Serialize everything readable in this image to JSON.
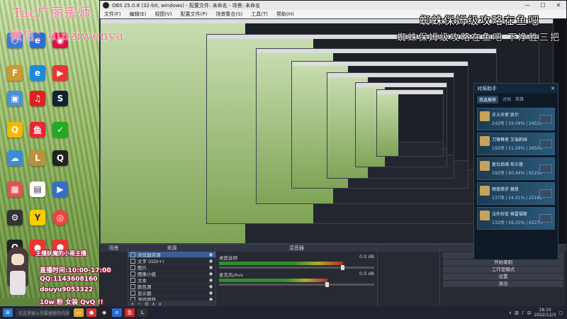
{
  "obs": {
    "title": "OBS 25.0.8 (32-bit, windows) - 配置文件: 未命名 - 场景: 未命名",
    "menu": [
      "文件(F)",
      "编辑(E)",
      "视图(V)",
      "配置文件(P)",
      "场景集合(S)",
      "工具(T)",
      "帮助(H)"
    ],
    "window_controls": [
      "—",
      "☐",
      "✕"
    ]
  },
  "overlay": {
    "teacher": "Tac广丽宗师",
    "wechat": "微信：dinziwenya",
    "headline": "蜘蛛保姆级攻略在鱼吧",
    "subline": "蜘蛛保姆级攻略在鱼吧 下净胜三把"
  },
  "game": {
    "header": "对局助手",
    "tabs": [
      "我选推荐",
      "对局",
      "英雄"
    ],
    "rows": [
      {
        "name": "正义天使 凯尔",
        "stat": "242场 | 59.09% | 24511"
      },
      {
        "name": "刀锋舞者 艾瑞莉娅",
        "stat": "192场 | 51.29% | 26509"
      },
      {
        "name": "复仇焰魂 布兰德",
        "stat": "192场 | 60.44% | 91214"
      },
      {
        "name": "暗夜猎手 薇恩",
        "stat": "137场 | 54.01% | 25162"
      },
      {
        "name": "法外狂徒 格雷福斯",
        "stat": "132场 | 56.25% | 62273"
      }
    ]
  },
  "docks": {
    "scenes_header": "场景",
    "sources_header": "来源",
    "mixer_header": "混音器",
    "controls_header": "控件",
    "sources": [
      "浏览器资源",
      "文字 (GDI+)",
      "图片",
      "图像小组",
      "文本",
      "颜色源",
      "显示器",
      "游戏捕获"
    ],
    "mixer": [
      {
        "name": "桌面音频",
        "db": "0.0 dB",
        "level": 0.8
      },
      {
        "name": "麦克风/Aux",
        "db": "0.0 dB",
        "level": 0.7
      }
    ],
    "controls": [
      "停止推流",
      "开始录制",
      "工作室模式",
      "设置",
      "退出"
    ],
    "footer_icons": [
      "+",
      "−",
      "⚙",
      "∧",
      "∨"
    ]
  },
  "streamer": {
    "line1": "主播妖魔的小哥主播",
    "line2": "直播时间:10:00-17:00",
    "line3": "QQ:1143608160",
    "line4": "douyu9053322",
    "line5": "10w 粉 女装 QvQ !!"
  },
  "taskbar": {
    "search_placeholder": "在这里输入你要搜索的内容",
    "time": "18:10",
    "date": "2022/12/3",
    "lang": "中"
  },
  "colors": {
    "accent_pink": "#ff6b9a",
    "obs_bg": "#2b2e38",
    "selected": "#3b5f95"
  }
}
